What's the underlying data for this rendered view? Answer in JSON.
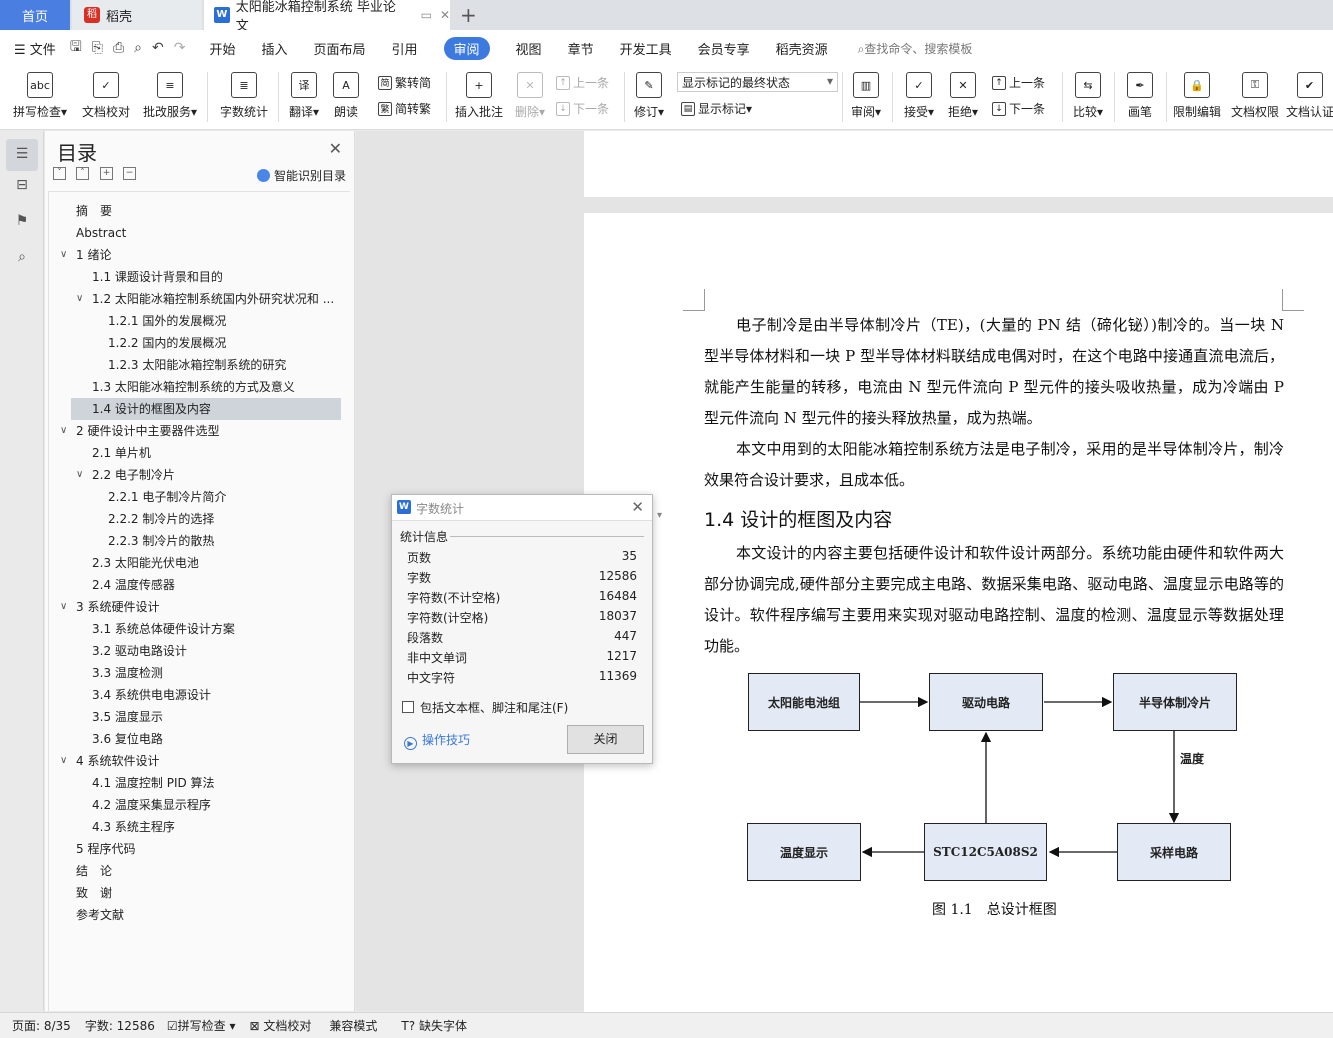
{
  "tabs": {
    "home": "首页",
    "docer": "稻壳",
    "doc": "太阳能冰箱控制系统 毕业论文",
    "new": "+"
  },
  "menu": {
    "file": "文件",
    "items": [
      "开始",
      "插入",
      "页面布局",
      "引用",
      "审阅",
      "视图",
      "章节",
      "开发工具",
      "会员专享",
      "稻壳资源"
    ],
    "search": "查找命令、搜索模板"
  },
  "ribbon": {
    "spell": "拼写检查",
    "doccheck": "文档校对",
    "batch": "批改服务",
    "wordcount": "字数统计",
    "translate": "翻译",
    "read": "朗读",
    "trad": "繁转简",
    "simp": "简转繁",
    "insert_comment": "插入批注",
    "delete": "删除",
    "prev": "上一条",
    "next": "下一条",
    "revise": "修订",
    "mark_state": "显示标记的最终状态",
    "show_marks": "显示标记",
    "review": "审阅",
    "accept": "接受",
    "reject": "拒绝",
    "prev2": "上一条",
    "next2": "下一条",
    "compare": "比较",
    "pen": "画笔",
    "restrict": "限制编辑",
    "perm": "文档权限",
    "auth": "文档认证"
  },
  "toc": {
    "title": "目录",
    "smart": "智能识别目录",
    "items": [
      "摘　要",
      "Abstract",
      "1  绪论",
      "1.1 课题设计背景和目的",
      "1.2  太阳能冰箱控制系统国内外研究状况和 ...",
      "1.2.1 国外的发展概况",
      "1.2.2  国内的发展概况",
      "1.2.3  太阳能冰箱控制系统的研究",
      "1.3 太阳能冰箱控制系统的方式及意义",
      "1.4 设计的框图及内容",
      "2  硬件设计中主要器件选型",
      "2.1 单片机",
      "2.2  电子制冷片",
      "2.2.1  电子制冷片简介",
      "2.2.2  制冷片的选择",
      "2.2.3  制冷片的散热",
      "2.3  太阳能光伏电池",
      "2.4  温度传感器",
      "3  系统硬件设计",
      "3.1 系统总体硬件设计方案",
      "3.2  驱动电路设计",
      "3.3  温度检测",
      "3.4  系统供电电源设计",
      "3.5  温度显示",
      "3.6  复位电路",
      "4  系统软件设计",
      "4.1  温度控制 PID 算法",
      "4.2  温度采集显示程序",
      "4.3  系统主程序",
      "5  程序代码",
      "结　论",
      "致　谢",
      "参考文献"
    ]
  },
  "doc": {
    "p1": "电子制冷是由半导体制冷片（TE)，(大量的 PN 结（碲化铋）)制冷的。当一块 N 型半导体材料和一块 P 型半导体材料联结成电偶对时，在这个电路中接通直流电流后，就能产生能量的转移，电流由 N 型元件流向 P 型元件的接头吸收热量，成为冷端由 P 型元件流向 N 型元件的接头释放热量，成为热端。",
    "p2": "本文中用到的太阳能冰箱控制系统方法是电子制冷，采用的是半导体制冷片，制冷效果符合设计要求，且成本低。",
    "heading": "1.4 设计的框图及内容",
    "p3": "本文设计的内容主要包括硬件设计和软件设计两部分。系统功能由硬件和软件两大部分协调完成,硬件部分主要完成主电路、数据采集电路、驱动电路、温度显示电路等的设计。软件程序编写主要用来实现对驱动电路控制、温度的检测、温度显示等数据处理功能。",
    "diagram": {
      "solar": "太阳能电池组",
      "drive": "驱动电路",
      "peltier": "半导体制冷片",
      "temp_label": "温度",
      "display": "温度显示",
      "mcu": "STC12C5A08S2",
      "sample": "采样电路"
    },
    "caption": "图 1.1　总设计框图"
  },
  "dialog": {
    "title": "字数统计",
    "section": "统计信息",
    "stats": [
      {
        "label": "页数",
        "value": "35"
      },
      {
        "label": "字数",
        "value": "12586"
      },
      {
        "label": "字符数(不计空格)",
        "value": "16484"
      },
      {
        "label": "字符数(计空格)",
        "value": "18037"
      },
      {
        "label": "段落数",
        "value": "447"
      },
      {
        "label": "非中文单词",
        "value": "1217"
      },
      {
        "label": "中文字符",
        "value": "11369"
      }
    ],
    "checkbox": "包括文本框、脚注和尾注(F)",
    "tips": "操作技巧",
    "close": "关闭"
  },
  "status": {
    "page": "页面: 8/35",
    "words": "字数: 12586",
    "spell": "拼写检查",
    "doccheck": "文档校对",
    "compat": "兼容模式",
    "missing": "缺失字体"
  }
}
